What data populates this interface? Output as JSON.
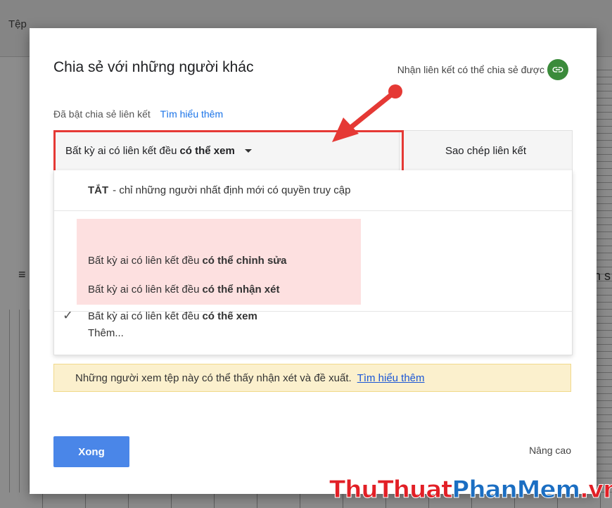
{
  "background": {
    "menu_label": "Tệp",
    "right_fragment": "n s"
  },
  "dialog": {
    "title": "Chia sẻ với những người khác",
    "get_link_label": "Nhận liên kết có thể chia sẻ được",
    "link_sharing_status": "Đã bật chia sẻ liên kết",
    "learn_more": "Tìm hiểu thêm",
    "access": {
      "selected_prefix": "Bất kỳ ai có liên kết đều",
      "selected_bold": "có thể xem",
      "copy_link_label": "Sao chép liên kết"
    },
    "menu": {
      "off_bold": "TẮT",
      "off_text": "- chỉ những người nhất định mới có quyền truy cập",
      "options": [
        {
          "prefix": "Bất kỳ ai có liên kết đều",
          "bold": "có thể chỉnh sửa",
          "checked": false
        },
        {
          "prefix": "Bất kỳ ai có liên kết đều",
          "bold": "có thể nhận xét",
          "checked": false
        },
        {
          "prefix": "Bất kỳ ai có liên kết đều",
          "bold": "có thể xem",
          "checked": true
        }
      ],
      "check_glyph": "✓",
      "more_label": "Thêm..."
    },
    "notice": {
      "text": "Những người xem tệp này có thể thấy nhận xét và đề xuất.",
      "link": "Tìm hiểu thêm"
    },
    "done_label": "Xong",
    "advanced_label": "Nâng cao"
  },
  "watermark": {
    "part1": "ThuThuat",
    "part2": "PhanMem",
    "part3": ".vn"
  },
  "colors": {
    "accent_blue": "#4a86e8",
    "link_icon_green": "#3b8b3b",
    "highlight_red": "#e53935",
    "option_highlight": "#fde0e0",
    "notice_bg": "#fbf0cd"
  }
}
